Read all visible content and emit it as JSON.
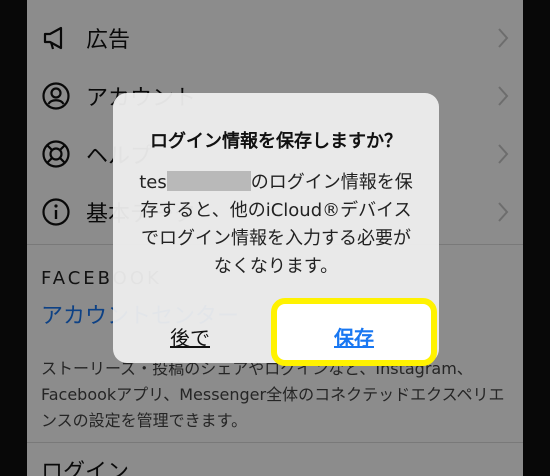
{
  "settings": {
    "items": [
      {
        "label": "広告",
        "icon": "megaphone-icon"
      },
      {
        "label": "アカウント",
        "icon": "account-icon"
      },
      {
        "label": "ヘルプ",
        "icon": "help-icon"
      },
      {
        "label": "基本データ",
        "icon": "info-icon"
      }
    ],
    "section_title": "FACEBOOK",
    "account_center_link": "アカウントセンター",
    "account_center_desc": "ストーリーズ・投稿のシェアやログインなど、Instagram、Facebookアプリ、Messenger全体のコネクテッドエクスペリエンスの設定を管理できます。",
    "bottom_item": "ログイン"
  },
  "dialog": {
    "title": "ログイン情報を保存しますか？",
    "message_prefix": "tes",
    "message_suffix": "のログイン情報を保存すると、他のiCloud®デバイスでログイン情報を入力する必要がなくなります。",
    "later_label": "後で",
    "save_label": "保存"
  },
  "colors": {
    "link_blue": "#1877f2",
    "highlight_yellow": "#fff200",
    "overlay": "rgba(0,0,0,0.45)"
  }
}
